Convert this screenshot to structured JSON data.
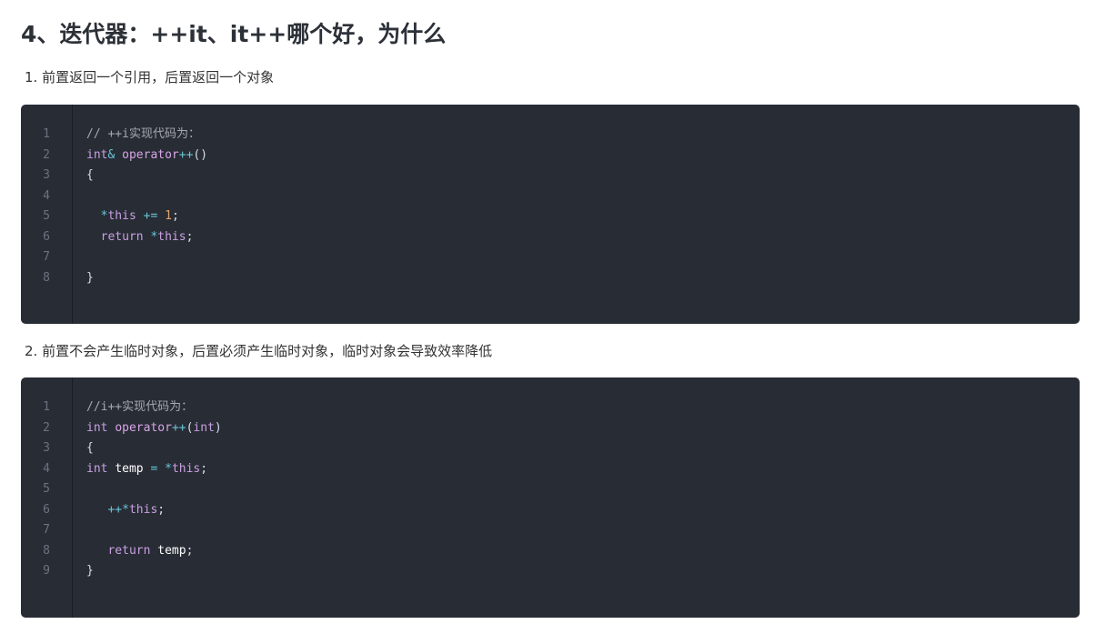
{
  "heading": "4、迭代器：++it、it++哪个好，为什么",
  "point1": "1. 前置返回一个引用，后置返回一个对象",
  "point2": "2. 前置不会产生临时对象，后置必须产生临时对象，临时对象会导致效率降低",
  "code_block_1": {
    "lines": [
      {
        "num": "1",
        "indent": 0,
        "tokens": [
          {
            "t": "// ++i实现代码为：",
            "c": "comment"
          }
        ]
      },
      {
        "num": "2",
        "indent": 0,
        "tokens": [
          {
            "t": "int",
            "c": "type"
          },
          {
            "t": "&",
            "c": "op"
          },
          {
            "t": " ",
            "c": "punc"
          },
          {
            "t": "operator",
            "c": "fn"
          },
          {
            "t": "++",
            "c": "op"
          },
          {
            "t": "()",
            "c": "punc"
          }
        ]
      },
      {
        "num": "3",
        "indent": 0,
        "tokens": [
          {
            "t": "{",
            "c": "punc"
          }
        ]
      },
      {
        "num": "4",
        "indent": 0,
        "tokens": []
      },
      {
        "num": "5",
        "indent": 2,
        "tokens": [
          {
            "t": "*",
            "c": "op"
          },
          {
            "t": "this",
            "c": "kw"
          },
          {
            "t": " ",
            "c": "punc"
          },
          {
            "t": "+=",
            "c": "op"
          },
          {
            "t": " ",
            "c": "punc"
          },
          {
            "t": "1",
            "c": "num"
          },
          {
            "t": ";",
            "c": "punc"
          }
        ]
      },
      {
        "num": "6",
        "indent": 2,
        "tokens": [
          {
            "t": "return",
            "c": "kw"
          },
          {
            "t": " ",
            "c": "punc"
          },
          {
            "t": "*",
            "c": "op"
          },
          {
            "t": "this",
            "c": "kw"
          },
          {
            "t": ";",
            "c": "punc"
          }
        ]
      },
      {
        "num": "7",
        "indent": 0,
        "tokens": []
      },
      {
        "num": "8",
        "indent": 0,
        "tokens": [
          {
            "t": "}",
            "c": "punc"
          }
        ]
      }
    ]
  },
  "code_block_2": {
    "lines": [
      {
        "num": "1",
        "indent": 0,
        "tokens": [
          {
            "t": "//i++实现代码为：",
            "c": "comment"
          }
        ]
      },
      {
        "num": "2",
        "indent": 0,
        "tokens": [
          {
            "t": "int",
            "c": "type"
          },
          {
            "t": " ",
            "c": "punc"
          },
          {
            "t": "operator",
            "c": "fn"
          },
          {
            "t": "++",
            "c": "op"
          },
          {
            "t": "(",
            "c": "punc"
          },
          {
            "t": "int",
            "c": "type"
          },
          {
            "t": ")",
            "c": "punc"
          }
        ]
      },
      {
        "num": "3",
        "indent": 0,
        "tokens": [
          {
            "t": "{",
            "c": "punc"
          }
        ]
      },
      {
        "num": "4",
        "indent": 0,
        "tokens": [
          {
            "t": "int",
            "c": "type"
          },
          {
            "t": " ",
            "c": "punc"
          },
          {
            "t": "temp",
            "c": "var"
          },
          {
            "t": " ",
            "c": "punc"
          },
          {
            "t": "=",
            "c": "op"
          },
          {
            "t": " ",
            "c": "punc"
          },
          {
            "t": "*",
            "c": "op"
          },
          {
            "t": "this",
            "c": "kw"
          },
          {
            "t": ";",
            "c": "punc"
          }
        ]
      },
      {
        "num": "5",
        "indent": 0,
        "tokens": []
      },
      {
        "num": "6",
        "indent": 3,
        "tokens": [
          {
            "t": "++",
            "c": "op"
          },
          {
            "t": "*",
            "c": "op"
          },
          {
            "t": "this",
            "c": "kw"
          },
          {
            "t": ";",
            "c": "punc"
          }
        ]
      },
      {
        "num": "7",
        "indent": 0,
        "tokens": []
      },
      {
        "num": "8",
        "indent": 3,
        "tokens": [
          {
            "t": "return",
            "c": "kw"
          },
          {
            "t": " ",
            "c": "punc"
          },
          {
            "t": "temp",
            "c": "var"
          },
          {
            "t": ";",
            "c": "punc"
          }
        ]
      },
      {
        "num": "9",
        "indent": 0,
        "tokens": [
          {
            "t": "}",
            "c": "punc"
          }
        ]
      }
    ]
  }
}
